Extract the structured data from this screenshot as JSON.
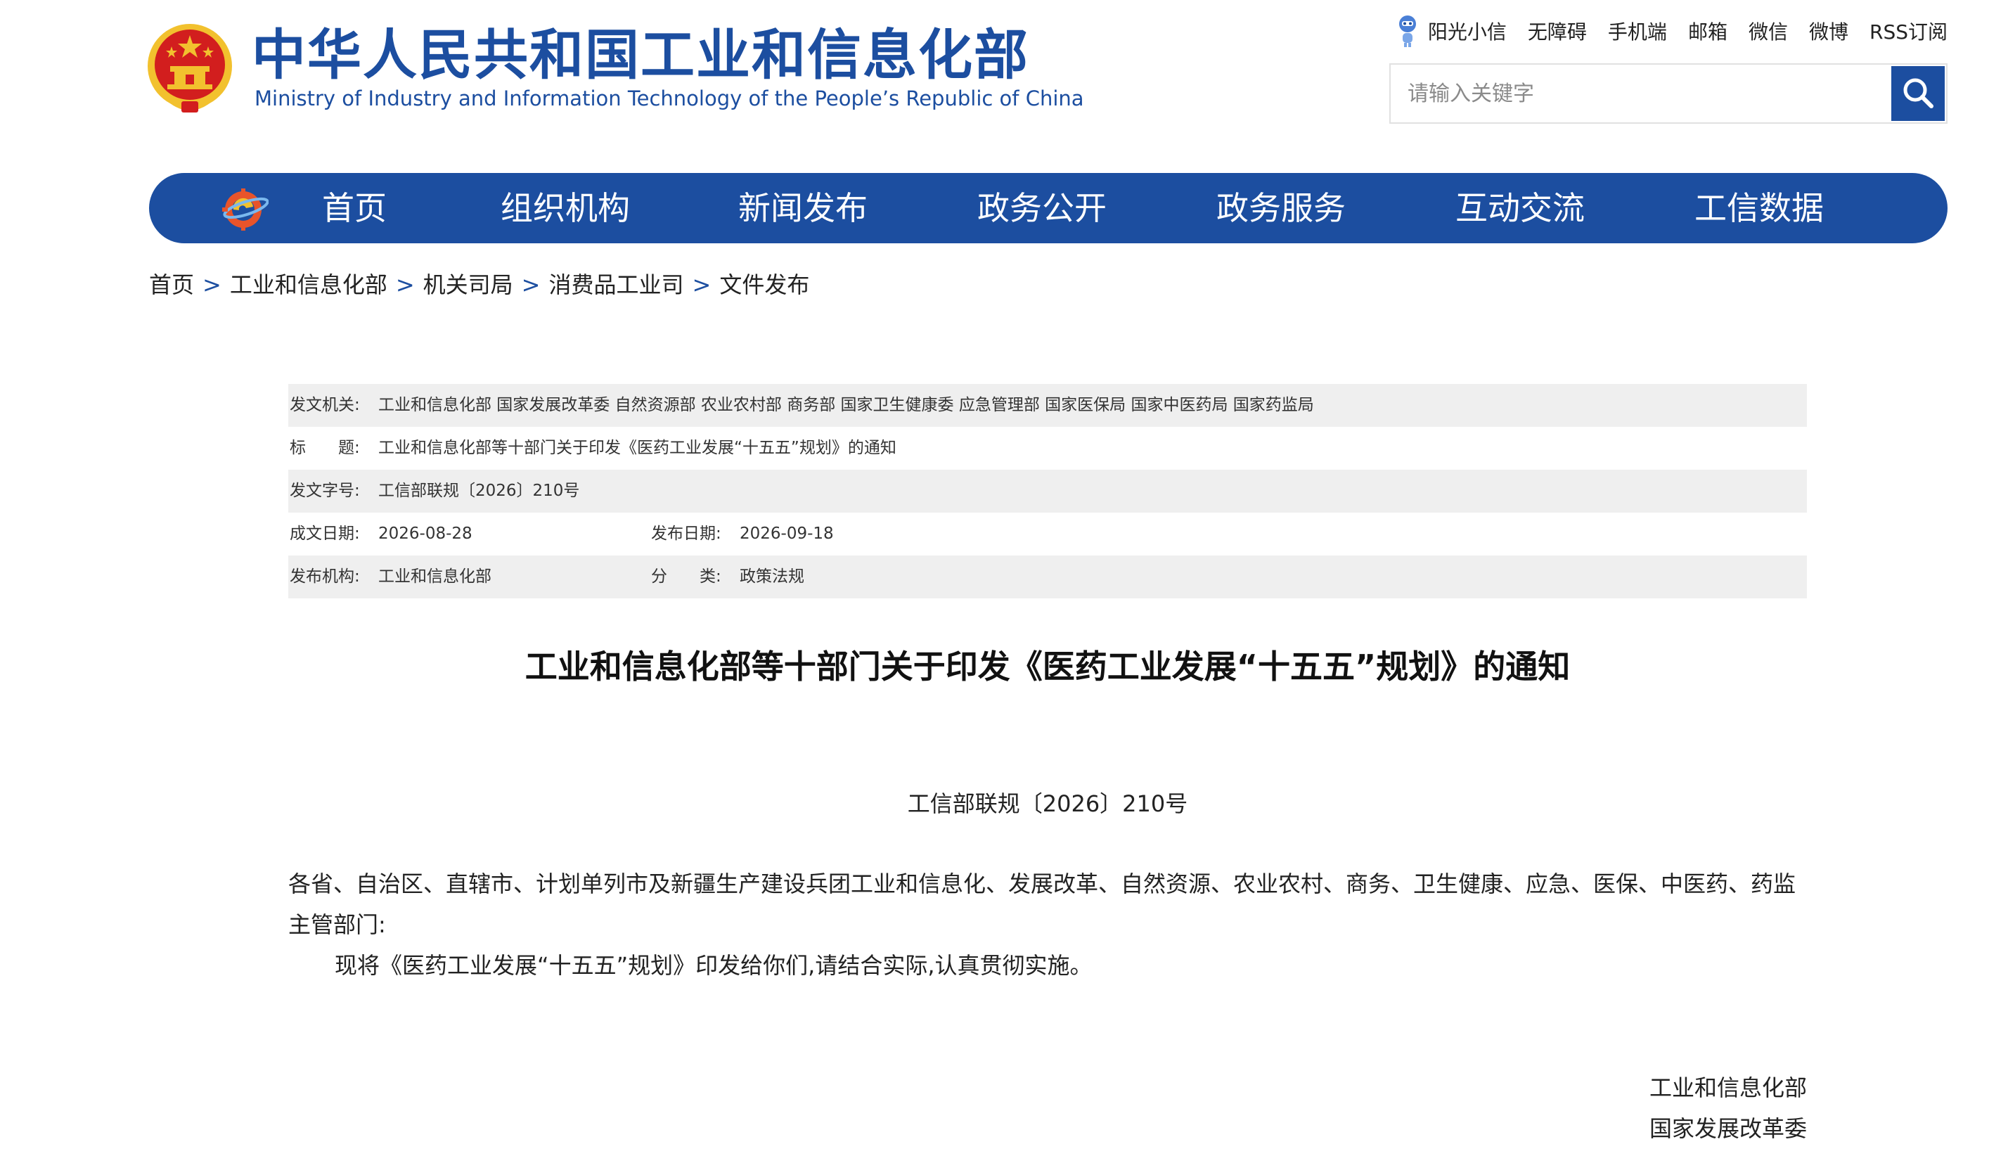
{
  "header": {
    "title": "中华人民共和国工业和信息化部",
    "subtitle": "Ministry of Industry and Information Technology of the People’s Republic of China",
    "top_links": [
      "阳光小信",
      "无障碍",
      "手机端",
      "邮箱",
      "微信",
      "微博",
      "RSS订阅"
    ],
    "search": {
      "placeholder": "请输入关键字",
      "value": ""
    }
  },
  "nav": {
    "items": [
      "首页",
      "组织机构",
      "新闻发布",
      "政务公开",
      "政务服务",
      "互动交流",
      "工信数据"
    ]
  },
  "breadcrumb": [
    "首页",
    "工业和信息化部",
    "机关司局",
    "消费品工业司",
    "文件发布"
  ],
  "breadcrumb_separator": ">",
  "meta": {
    "issuer_label": "发文机关:",
    "issuer_value": "工业和信息化部 国家发展改革委 自然资源部 农业农村部 商务部 国家卫生健康委 应急管理部 国家医保局 国家中医药局 国家药监局",
    "title_label": "标　　题:",
    "title_value": "工业和信息化部等十部门关于印发《医药工业发展“十五五”规划》的通知",
    "docno_label": "发文字号:",
    "docno_value": "工信部联规〔2026〕210号",
    "written_label": "成文日期:",
    "written_value": "2026-08-28",
    "published_label": "发布日期:",
    "published_value": "2026-09-18",
    "org_label": "发布机构:",
    "org_value": "工业和信息化部",
    "category_label": "分　　类:",
    "category_value": "政策法规"
  },
  "document": {
    "title": "工业和信息化部等十部门关于印发《医药工业发展“十五五”规划》的通知",
    "number": "工信部联规〔2026〕210号",
    "para1": "各省、自治区、直辖市、计划单列市及新疆生产建设兵团工业和信息化、发展改革、自然资源、农业农村、商务、卫生健康、应急、医保、中医药、药监主管部门:",
    "para2": "现将《医药工业发展“十五五”规划》印发给你们,请结合实际,认真贯彻实施。",
    "signers": [
      "工业和信息化部",
      "国家发展改革委"
    ]
  },
  "colors": {
    "brand_blue": "#1c4ea0",
    "emblem_red": "#d21e1e",
    "emblem_gold": "#f2c12e",
    "row_shade": "#efefef"
  },
  "icons": {
    "emblem": "national-emblem-icon",
    "robot": "robot-assistant-icon",
    "search": "search-icon",
    "nav_logo": "miit-logo-icon"
  }
}
